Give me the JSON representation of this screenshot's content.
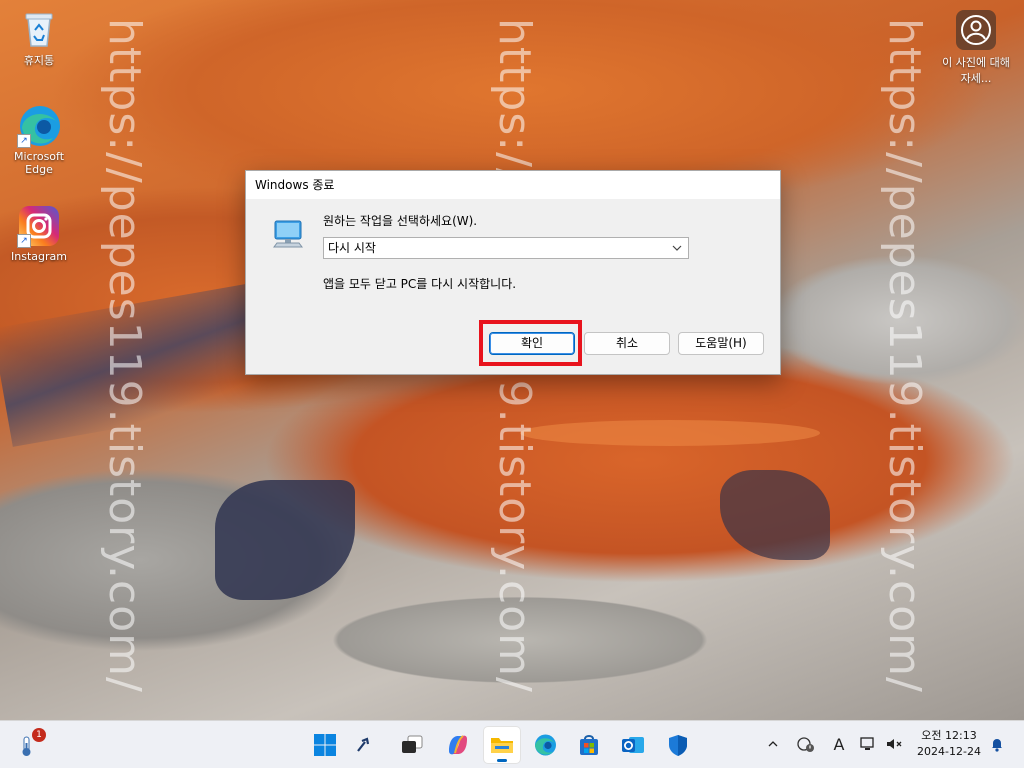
{
  "desktop": {
    "watermark": "https://pepes119.tistory.com/",
    "icons": [
      {
        "label": "휴지통",
        "icon": "recycle-bin-icon"
      },
      {
        "label": "Microsoft Edge",
        "icon": "edge-icon"
      },
      {
        "label": "Instagram",
        "icon": "instagram-icon"
      }
    ],
    "photo_info": {
      "label": "이 사진에 대해 자세...",
      "icon": "photo-info-icon"
    }
  },
  "dialog": {
    "title": "Windows 종료",
    "prompt": "원하는 작업을 선택하세요(W).",
    "selected_option": "다시 시작",
    "description": "앱을 모두 닫고 PC를 다시 시작합니다.",
    "buttons": {
      "ok": "확인",
      "cancel": "취소",
      "help": "도움말(H)"
    },
    "highlight_color": "#e8131d"
  },
  "taskbar": {
    "weather_badge": "1",
    "apps": [
      {
        "name": "start",
        "icon": "windows-start-icon"
      },
      {
        "name": "widgets",
        "icon": "tools-icon"
      },
      {
        "name": "task-view",
        "icon": "task-view-icon"
      },
      {
        "name": "copilot",
        "icon": "copilot-icon"
      },
      {
        "name": "file-explorer",
        "icon": "folder-icon",
        "active": true
      },
      {
        "name": "edge",
        "icon": "edge-icon"
      },
      {
        "name": "store",
        "icon": "store-icon"
      },
      {
        "name": "outlook",
        "icon": "outlook-icon"
      },
      {
        "name": "defender",
        "icon": "shield-icon"
      }
    ],
    "tray": {
      "ime": "A",
      "time": "오전 12:13",
      "date": "2024-12-24"
    },
    "accent": "#0067c0"
  }
}
